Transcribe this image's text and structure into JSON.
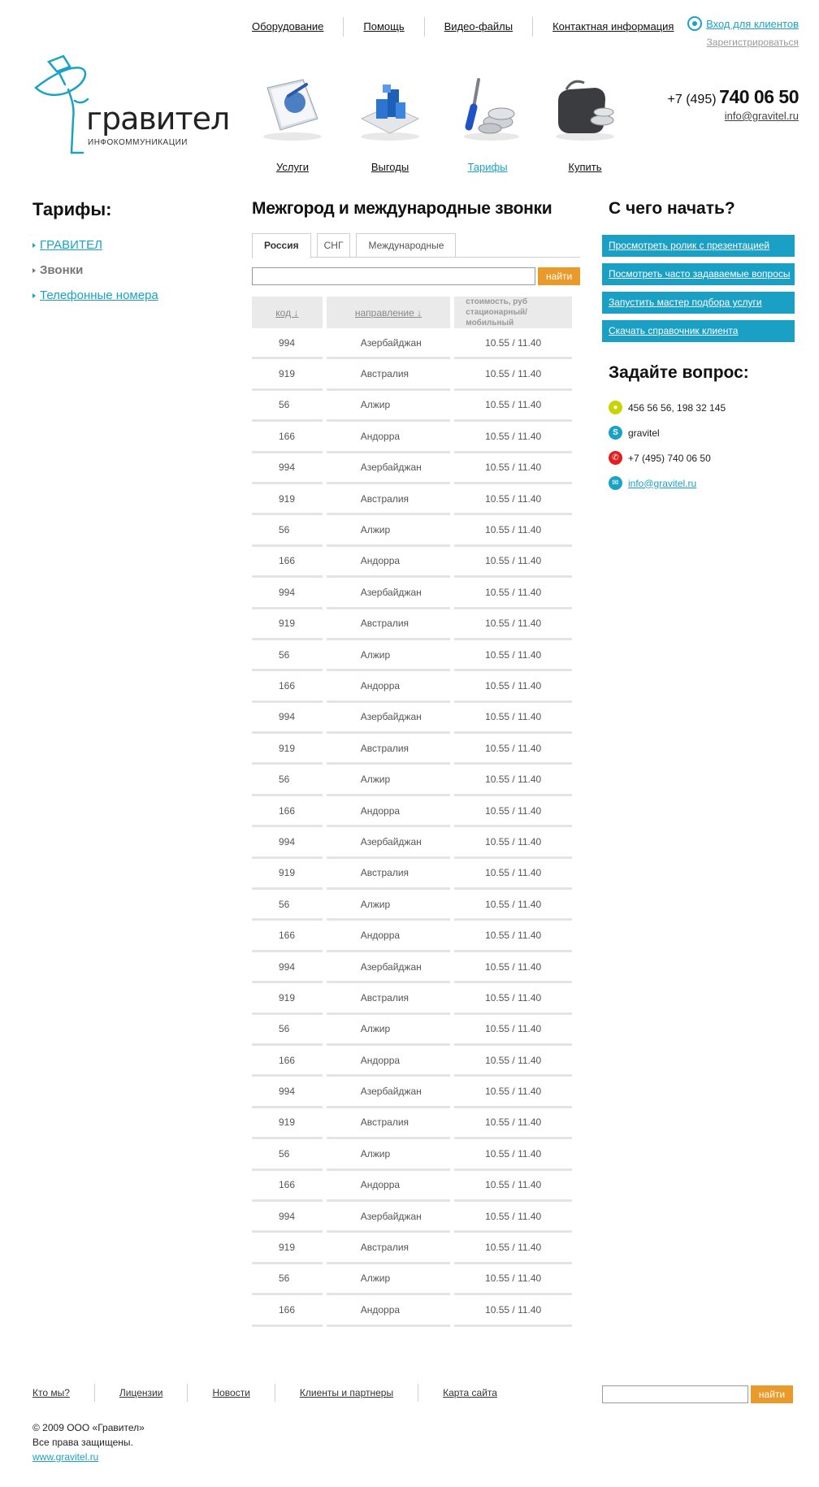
{
  "topnav": {
    "items": [
      "Оборудование",
      "Помощь",
      "Видео-файлы",
      "Контактная информация"
    ],
    "login": "Вход для клиентов",
    "register": "Зарегистрироваться"
  },
  "logo": {
    "name": "гравител",
    "tagline": "ИНФОКОММУНИКАЦИИ"
  },
  "menu": {
    "items": [
      {
        "label": "Услуги",
        "icon": "book-icon",
        "active": false
      },
      {
        "label": "Выгоды",
        "icon": "chart-cubes-icon",
        "active": false
      },
      {
        "label": "Тарифы",
        "icon": "tools-coins-icon",
        "active": true
      },
      {
        "label": "Купить",
        "icon": "wallet-coins-icon",
        "active": false
      }
    ]
  },
  "contacts_top": {
    "phone_prefix": "+7 (495)",
    "phone_main": "740 06 50",
    "email": "info@gravitel.ru"
  },
  "left": {
    "title": "Тарифы:",
    "items": [
      {
        "label": "ГРАВИТЕЛ",
        "current": false
      },
      {
        "label": "Звонки",
        "current": true
      },
      {
        "label": "Телефонные номера",
        "current": false
      }
    ]
  },
  "center": {
    "title": "Межгород и международные звонки",
    "tabs": [
      "Россия",
      "СНГ",
      "Международные"
    ],
    "search_button": "найти",
    "columns": {
      "code": "код ↓",
      "direction": "направление ↓",
      "cost_line1": "стоимость, руб",
      "cost_line2": "стационарный/мобильный"
    },
    "rows": [
      [
        "994",
        "Азербайджан",
        "10.55 / 11.40"
      ],
      [
        "919",
        "Австралия",
        "10.55 / 11.40"
      ],
      [
        "56",
        "Алжир",
        "10.55 / 11.40"
      ],
      [
        "166",
        "Андорра",
        "10.55 / 11.40"
      ],
      [
        "994",
        "Азербайджан",
        "10.55 / 11.40"
      ],
      [
        "919",
        "Австралия",
        "10.55 / 11.40"
      ],
      [
        "56",
        "Алжир",
        "10.55 / 11.40"
      ],
      [
        "166",
        "Андорра",
        "10.55 / 11.40"
      ],
      [
        "994",
        "Азербайджан",
        "10.55 / 11.40"
      ],
      [
        "919",
        "Австралия",
        "10.55 / 11.40"
      ],
      [
        "56",
        "Алжир",
        "10.55 / 11.40"
      ],
      [
        "166",
        "Андорра",
        "10.55 / 11.40"
      ],
      [
        "994",
        "Азербайджан",
        "10.55 / 11.40"
      ],
      [
        "919",
        "Австралия",
        "10.55 / 11.40"
      ],
      [
        "56",
        "Алжир",
        "10.55 / 11.40"
      ],
      [
        "166",
        "Андорра",
        "10.55 / 11.40"
      ],
      [
        "994",
        "Азербайджан",
        "10.55 / 11.40"
      ],
      [
        "919",
        "Австралия",
        "10.55 / 11.40"
      ],
      [
        "56",
        "Алжир",
        "10.55 / 11.40"
      ],
      [
        "166",
        "Андорра",
        "10.55 / 11.40"
      ],
      [
        "994",
        "Азербайджан",
        "10.55 / 11.40"
      ],
      [
        "919",
        "Австралия",
        "10.55 / 11.40"
      ],
      [
        "56",
        "Алжир",
        "10.55 / 11.40"
      ],
      [
        "166",
        "Андорра",
        "10.55 / 11.40"
      ],
      [
        "994",
        "Азербайджан",
        "10.55 / 11.40"
      ],
      [
        "919",
        "Австралия",
        "10.55 / 11.40"
      ],
      [
        "56",
        "Алжир",
        "10.55 / 11.40"
      ],
      [
        "166",
        "Андорра",
        "10.55 / 11.40"
      ],
      [
        "994",
        "Азербайджан",
        "10.55 / 11.40"
      ],
      [
        "919",
        "Австралия",
        "10.55 / 11.40"
      ],
      [
        "56",
        "Алжир",
        "10.55 / 11.40"
      ],
      [
        "166",
        "Андорра",
        "10.55 / 11.40"
      ]
    ]
  },
  "right": {
    "title": "С чего начать?",
    "links": [
      "Просмотреть ролик с презентацией",
      "Посмотреть часто задаваемые вопросы",
      "Запустить мастер подбора услуги",
      "Скачать справочник клиента"
    ],
    "ask_title": "Задайте вопрос:",
    "ask": [
      {
        "icon": "icq-icon",
        "text": "456 56 56, 198 32 145",
        "color": "#c8d400"
      },
      {
        "icon": "skype-icon",
        "text": "gravitel",
        "color": "#1aa2c6"
      },
      {
        "icon": "phone-icon",
        "text": "+7 (495) 740 06 50",
        "color": "#e02020"
      },
      {
        "icon": "mail-icon",
        "text": "info@gravitel.ru",
        "color": "#1aa2c6"
      }
    ]
  },
  "footer": {
    "links": [
      "Кто мы?",
      "Лицензии",
      "Новости",
      "Клиенты и партнеры",
      "Карта сайта"
    ],
    "search_button": "найти",
    "copyright": "© 2009 ООО «Гравител»",
    "rights": "Все права защищены.",
    "site": "www.gravitel.ru"
  },
  "colors": {
    "accent": "#1aa2c6",
    "button": "#e99a2a",
    "start_links_bg": "#1aa0c4"
  }
}
